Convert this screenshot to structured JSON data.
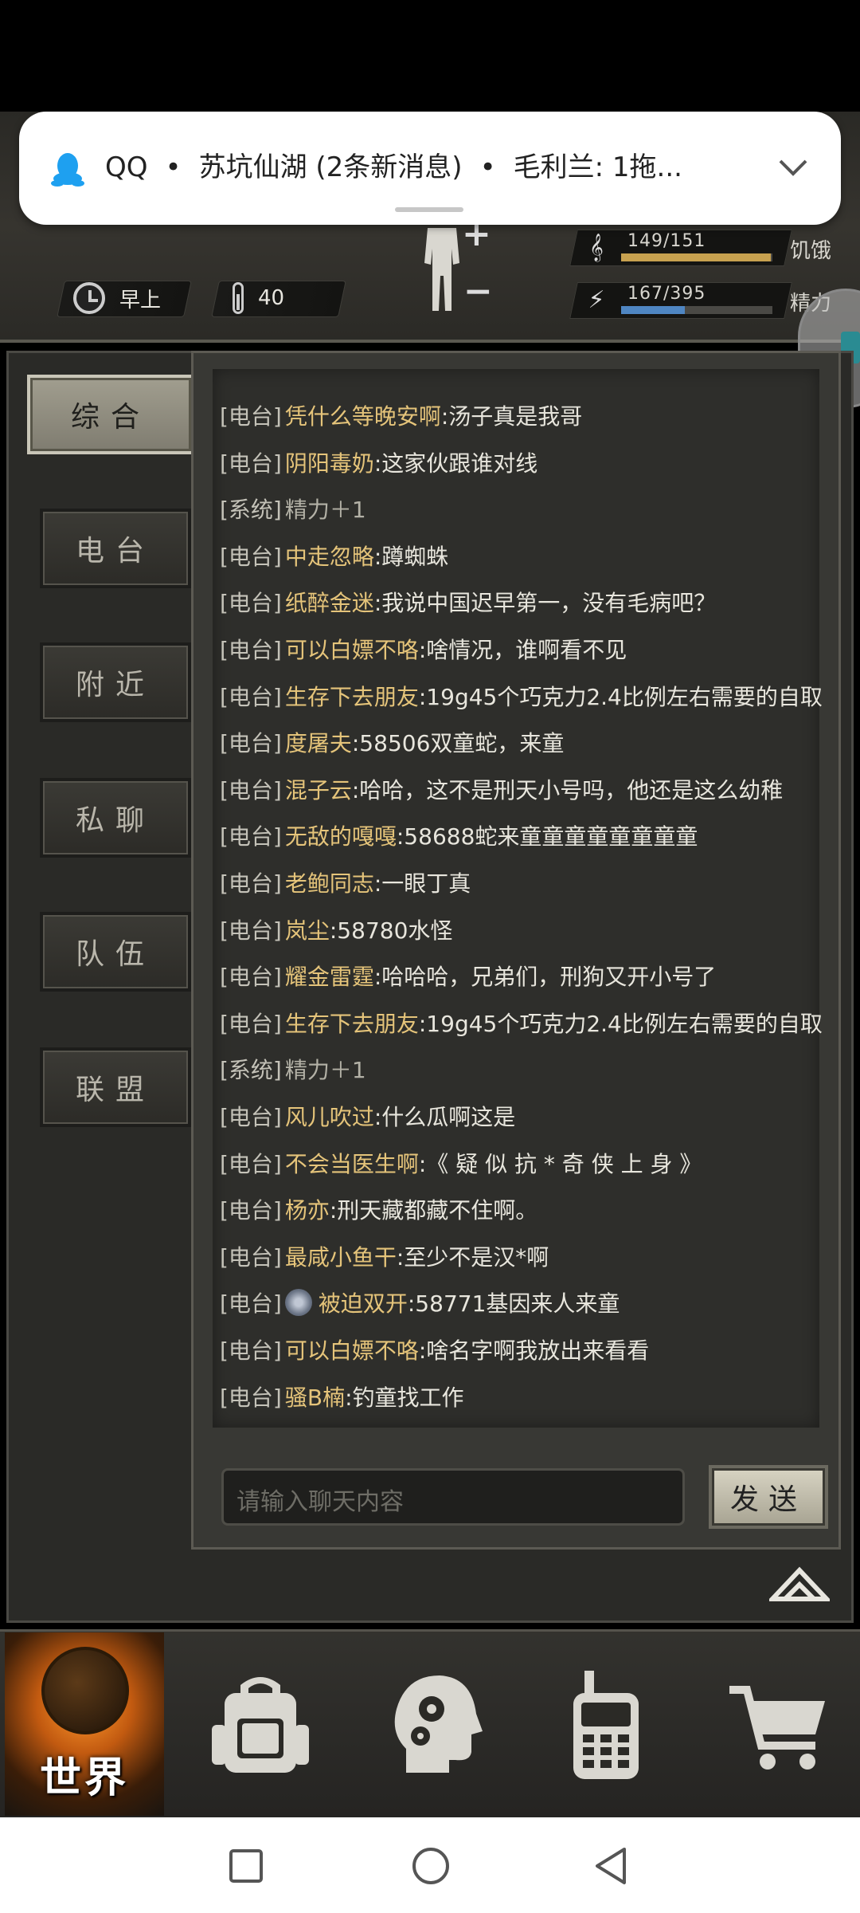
{
  "notification": {
    "app": "QQ",
    "separator": "•",
    "group": "苏坑仙湖 (2条新消息)",
    "preview": "毛利兰: 1拖..."
  },
  "header": {
    "time_label": "早上",
    "temperature": "40",
    "stats": [
      {
        "value": "149/151",
        "label": "饥饿",
        "fill": 0.987,
        "color": "#c7a14f",
        "icon": "stomach-icon"
      },
      {
        "value": "167/395",
        "label": "精力",
        "fill": 0.423,
        "color": "#4f86c2",
        "icon": "energy-icon"
      }
    ]
  },
  "tabs": [
    {
      "label": "综合",
      "active": true
    },
    {
      "label": "电台",
      "active": false
    },
    {
      "label": "附近",
      "active": false
    },
    {
      "label": "私聊",
      "active": false
    },
    {
      "label": "队伍",
      "active": false
    },
    {
      "label": "联盟",
      "active": false
    }
  ],
  "messages": [
    {
      "channel": "[电台]",
      "nick": "凭什么等晚安啊",
      "text": ":汤子真是我哥"
    },
    {
      "channel": "[电台]",
      "nick": "阴阳毒奶",
      "text": ":这家伙跟谁对线"
    },
    {
      "channel": "[系统]",
      "nick": "",
      "text": "精力＋1",
      "system": true
    },
    {
      "channel": "[电台]",
      "nick": "中走忽略",
      "text": ":蹲蜘蛛"
    },
    {
      "channel": "[电台]",
      "nick": "纸醉金迷",
      "text": ":我说中国迟早第一，没有毛病吧？"
    },
    {
      "channel": "[电台]",
      "nick": "可以白嫖不咯",
      "text": ":啥情况，谁啊看不见"
    },
    {
      "channel": "[电台]",
      "nick": "生存下去朋友",
      "text": ":19g45个巧克力2.4比例左右需要的自取"
    },
    {
      "channel": "[电台]",
      "nick": "度屠夫",
      "text": ":58506双童蛇，来童"
    },
    {
      "channel": "[电台]",
      "nick": "混子云",
      "text": ":哈哈，这不是刑天小号吗，他还是这么幼稚"
    },
    {
      "channel": "[电台]",
      "nick": "无敌的嘎嘎",
      "text": ":58688蛇来童童童童童童童童"
    },
    {
      "channel": "[电台]",
      "nick": "老鲍同志",
      "text": ":一眼丁真"
    },
    {
      "channel": "[电台]",
      "nick": "岚尘",
      "text": ":58780水怪"
    },
    {
      "channel": "[电台]",
      "nick": "耀金雷霆",
      "text": ":哈哈哈，兄弟们，刑狗又开小号了"
    },
    {
      "channel": "[电台]",
      "nick": "生存下去朋友",
      "text": ":19g45个巧克力2.4比例左右需要的自取"
    },
    {
      "channel": "[系统]",
      "nick": "",
      "text": "精力＋1",
      "system": true
    },
    {
      "channel": "[电台]",
      "nick": "风儿吹过",
      "text": ":什么瓜啊这是"
    },
    {
      "channel": "[电台]",
      "nick": "不会当医生啊",
      "text": ":《 疑 似 抗 * 奇 侠 上 身 》"
    },
    {
      "channel": "[电台]",
      "nick": "杨亦",
      "text": ":刑天藏都藏不住啊。"
    },
    {
      "channel": "[电台]",
      "nick": "最咸小鱼干",
      "text": ":至少不是汉*啊"
    },
    {
      "channel": "[电台]",
      "nick": "被迫双开",
      "text": ":58771基因来人来童",
      "badge": true
    },
    {
      "channel": "[电台]",
      "nick": "可以白嫖不咯",
      "text": ":啥名字啊我放出来看看"
    },
    {
      "channel": "[电台]",
      "nick": "骚B楠",
      "text": ":钓童找工作"
    }
  ],
  "chat_input": {
    "placeholder": "请输入聊天内容"
  },
  "send_label": "发送",
  "bottom_nav": {
    "world_label": "世界"
  }
}
